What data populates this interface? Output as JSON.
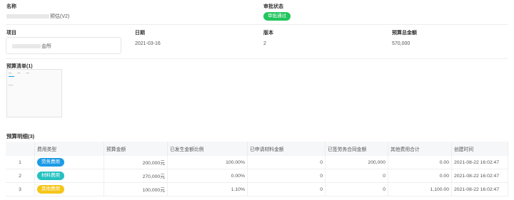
{
  "header": {
    "name_label": "名称",
    "name_value_suffix": "预估(V2)",
    "status_label": "审批状态",
    "status_value": "审批通过"
  },
  "info": {
    "project_label": "项目",
    "project_value_suffix": "会所",
    "date_label": "日期",
    "date_value": "2021-03-16",
    "version_label": "版本",
    "version_value": "2",
    "total_label": "预算总金额",
    "total_value": "570,000"
  },
  "budget_list": {
    "title": "预算清单(1)"
  },
  "detail": {
    "title": "预算明细(3)",
    "columns": [
      "",
      "费用类型",
      "预算金额",
      "已发生金额比例",
      "已申请材料金额",
      "已签劳务合同金额",
      "其他费用合计",
      "创建时间"
    ],
    "rows": [
      {
        "idx": "1",
        "type": "劳务费用",
        "type_color": "blue",
        "budget": "200,000元",
        "ratio": "100.00%",
        "material": "0",
        "labor": "200,000",
        "other": "0.00",
        "created": "2021-08-22 16:02:47"
      },
      {
        "idx": "2",
        "type": "材料费用",
        "type_color": "teal",
        "budget": "270,000元",
        "ratio": "0.00%",
        "material": "0",
        "labor": "0",
        "other": "0.00",
        "created": "2021-08-22 16:02:47"
      },
      {
        "idx": "3",
        "type": "其他费用",
        "type_color": "yellow",
        "budget": "100,000元",
        "ratio": "1.10%",
        "material": "0",
        "labor": "0",
        "other": "1,100.00",
        "created": "2021-08-22 16:02:47"
      }
    ]
  }
}
